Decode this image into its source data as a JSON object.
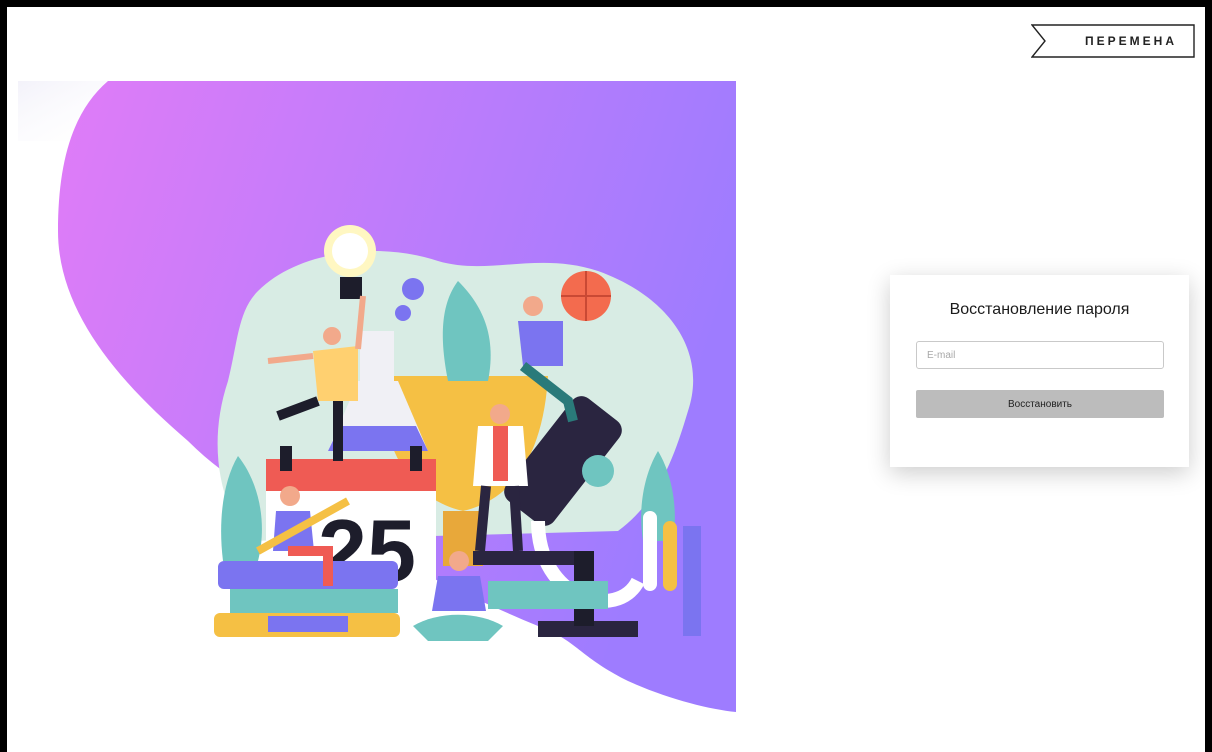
{
  "brand": {
    "logo_text": "ПЕРЕМЕНА"
  },
  "hero": {
    "illustration_icon": "education-illustration",
    "calendar_digit": "25",
    "background_gradient": [
      "#e07cf7",
      "#9e7cff"
    ]
  },
  "recovery_card": {
    "title": "Восстановление пароля",
    "email_placeholder": "E-mail",
    "email_value": "",
    "submit_label": "Восстановить"
  },
  "colors": {
    "button_bg": "#bcbcbc",
    "accent_purple": "#b079ff",
    "accent_pink": "#e070f0"
  }
}
